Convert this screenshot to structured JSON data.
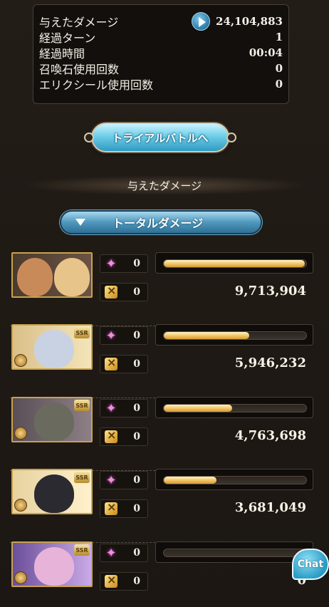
{
  "summary": {
    "rows": [
      {
        "label": "与えたダメージ",
        "value": "24,104,883"
      },
      {
        "label": "経過ターン",
        "value": "1"
      },
      {
        "label": "経過時間",
        "value": "00:04"
      },
      {
        "label": "召喚石使用回数",
        "value": "0"
      },
      {
        "label": "エリクシール使用回数",
        "value": "0"
      }
    ]
  },
  "trial_button": {
    "label": "トライアルバトルへ"
  },
  "section": {
    "title": "与えたダメージ"
  },
  "dropdown": {
    "label": "トータルダメージ"
  },
  "badges": {
    "ssr": "SSR"
  },
  "characters": [
    {
      "special": "0",
      "chain": "0",
      "damage": "9,713,904",
      "bar_fraction": 0.99,
      "colors": [
        "#c98a5a",
        "#e7c48a"
      ],
      "ssr": false
    },
    {
      "special": "0",
      "chain": "0",
      "damage": "5,946,232",
      "bar_fraction": 0.6,
      "colors": [
        "#c9d2e3",
        "#f3e6c6"
      ],
      "ssr": true
    },
    {
      "special": "0",
      "chain": "0",
      "damage": "4,763,698",
      "bar_fraction": 0.48,
      "colors": [
        "#6a6a5e",
        "#b3a9a0"
      ],
      "ssr": true
    },
    {
      "special": "0",
      "chain": "0",
      "damage": "3,681,049",
      "bar_fraction": 0.37,
      "colors": [
        "#2b2a30",
        "#d7b48a"
      ],
      "ssr": true
    },
    {
      "special": "0",
      "chain": "0",
      "damage": "0",
      "bar_fraction": 0.0,
      "colors": [
        "#8f7ab8",
        "#e7b3d9"
      ],
      "ssr": true
    }
  ],
  "chat": {
    "label": "Chat"
  }
}
